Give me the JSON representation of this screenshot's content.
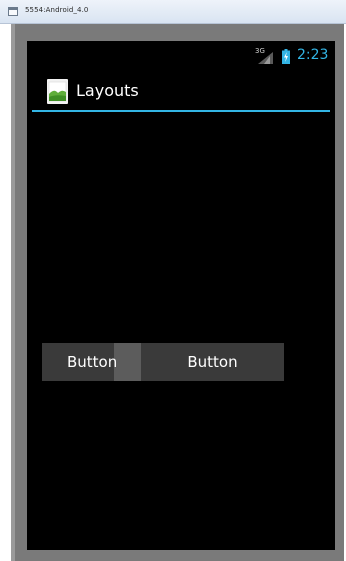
{
  "window": {
    "title": "5554:Android_4.0"
  },
  "status_bar": {
    "signal_label": "3G",
    "time": "2:23",
    "accent_color": "#33b5e5"
  },
  "action_bar": {
    "icon": "android-app-icon",
    "title": "Layouts"
  },
  "buttons": [
    {
      "label": "Button"
    },
    {
      "label": "Button"
    }
  ]
}
